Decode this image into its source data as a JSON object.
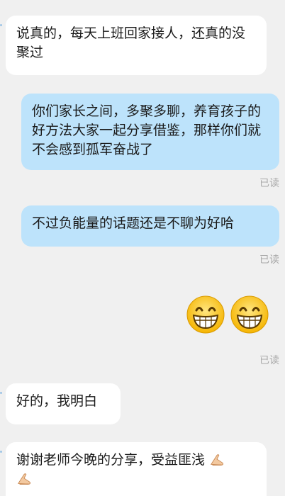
{
  "messages": [
    {
      "side": "in",
      "text": "说真的，每天上班回家接人，还真的没聚过"
    },
    {
      "side": "out",
      "text": "你们家长之间，多聚多聊，养育孩子的好方法大家一起分享借鉴，那样你们就不会感到孤军奋战了",
      "status": "已读"
    },
    {
      "side": "out",
      "text": "不过负能量的话题还是不聊为好哈",
      "status": "已读"
    },
    {
      "side": "out",
      "emoji": [
        "grinning-face",
        "grinning-face"
      ],
      "status": "已读"
    },
    {
      "side": "in",
      "text": "好的，我明白"
    },
    {
      "side": "in",
      "text": "谢谢老师今晚的分享，受益匪浅",
      "emoji": [
        "folded-hands",
        "folded-hands"
      ]
    }
  ]
}
